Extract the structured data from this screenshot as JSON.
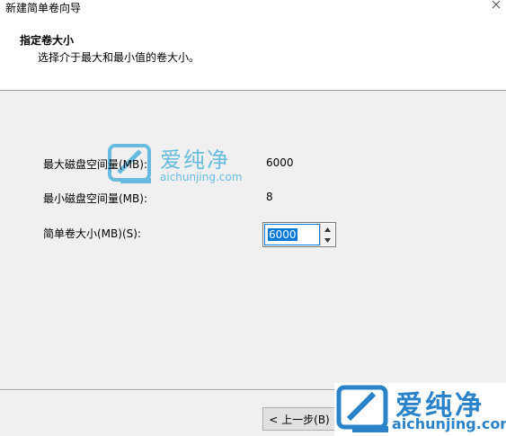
{
  "window": {
    "title": "新建简单卷向导"
  },
  "header": {
    "heading": "指定卷大小",
    "subheading": "选择介于最大和最小值的卷大小。"
  },
  "fields": {
    "max_label": "最大磁盘空间量(MB):",
    "max_value": "6000",
    "min_label": "最小磁盘空间量(MB):",
    "min_value": "8",
    "size_label": "简单卷大小(MB)(S):",
    "size_value": "6000"
  },
  "footer": {
    "back_label": "< 上一步(B)"
  },
  "watermark": {
    "name": "爱纯净",
    "domain": "aichunjing.com"
  },
  "colors": {
    "accent": "#0078d7",
    "watermark": "#3aaad8",
    "logo": "#2a82c9"
  }
}
